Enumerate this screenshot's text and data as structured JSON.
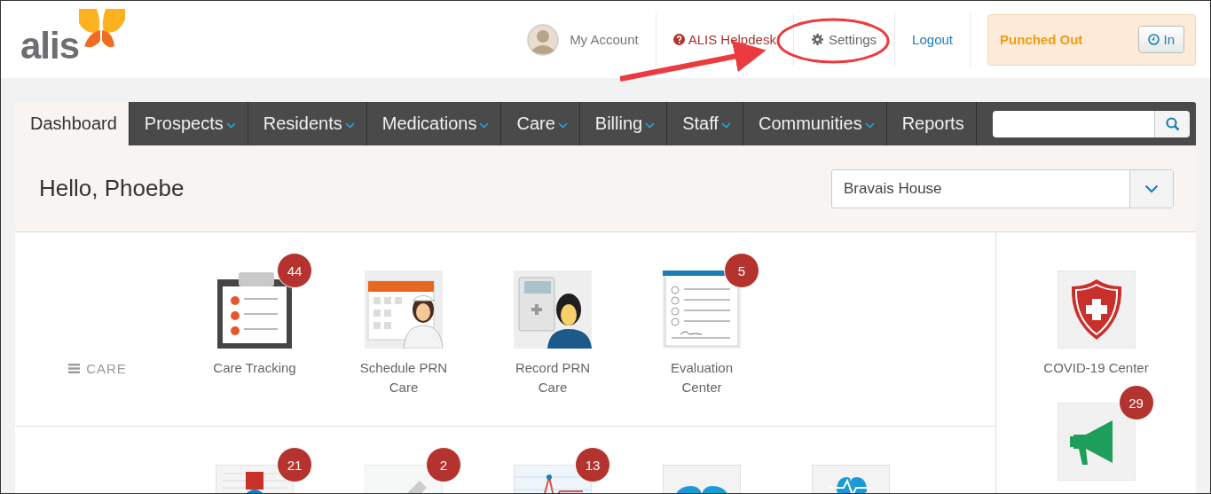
{
  "header": {
    "logo": "alis",
    "account": {
      "label": "My Account"
    },
    "helpdesk": {
      "label": "ALIS Helpdesk"
    },
    "settings": {
      "label": "Settings"
    },
    "logout": {
      "label": "Logout"
    },
    "punch": {
      "status": "Punched Out",
      "button": "In"
    }
  },
  "nav": {
    "tabs": [
      {
        "label": "Dashboard",
        "selected": true,
        "dropdown": false
      },
      {
        "label": "Prospects",
        "selected": false,
        "dropdown": true
      },
      {
        "label": "Residents",
        "selected": false,
        "dropdown": true
      },
      {
        "label": "Medications",
        "selected": false,
        "dropdown": true
      },
      {
        "label": "Care",
        "selected": false,
        "dropdown": true
      },
      {
        "label": "Billing",
        "selected": false,
        "dropdown": true
      },
      {
        "label": "Staff",
        "selected": false,
        "dropdown": true
      },
      {
        "label": "Communities",
        "selected": false,
        "dropdown": true
      },
      {
        "label": "Reports",
        "selected": false,
        "dropdown": false
      }
    ]
  },
  "greeting": "Hello, Phoebe",
  "community_select": {
    "value": "Bravais House"
  },
  "sections": [
    {
      "label": "CARE",
      "tiles": [
        {
          "label": "Care Tracking",
          "badge": "44",
          "kind": "clipboard"
        },
        {
          "label": "Schedule PRN Care",
          "kind": "calendar"
        },
        {
          "label": "Record PRN Care",
          "kind": "caregiver"
        },
        {
          "label": "Evaluation Center",
          "badge": "5",
          "kind": "form"
        }
      ]
    },
    {
      "tiles": [
        {
          "badge": "21",
          "kind": "document"
        },
        {
          "badge": "2",
          "kind": "pen"
        },
        {
          "badge": "13",
          "kind": "chart"
        },
        {
          "kind": "heart"
        },
        {
          "kind": "heartbeat"
        }
      ]
    }
  ],
  "side_tiles": [
    {
      "label": "COVID-19 Center",
      "kind": "shield"
    },
    {
      "badge": "29",
      "kind": "megaphone"
    }
  ]
}
